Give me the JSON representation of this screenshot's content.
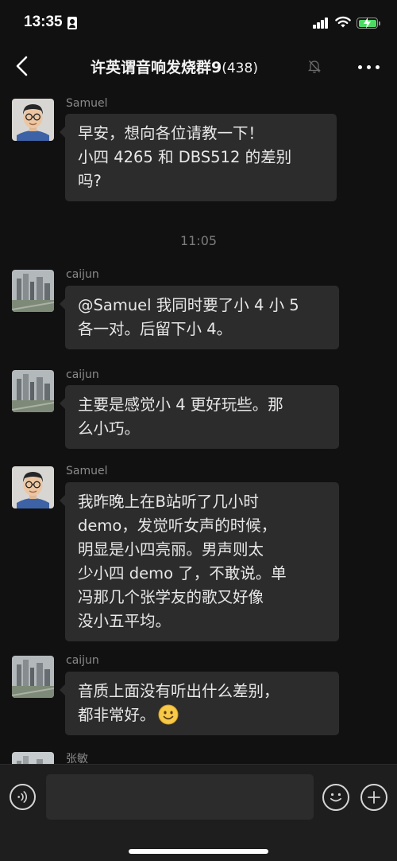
{
  "status_bar": {
    "time": "13:35",
    "icons": [
      "person-badge-icon",
      "signal-icon",
      "wifi-icon",
      "battery-charging-icon"
    ],
    "battery_color": "#4cd964"
  },
  "header": {
    "title": "许英谓音响发烧群9",
    "member_count": "(438)",
    "icons": [
      "back-icon",
      "mute-bell-icon",
      "more-icon"
    ]
  },
  "messages": [
    {
      "sender": "Samuel",
      "avatar": "samuel-avatar",
      "lines": [
        "早安，想向各位请教一下！",
        "小四 4265 和 DBS512 的差别",
        "吗?"
      ]
    },
    {
      "timestamp": "11:05"
    },
    {
      "sender": "caijun",
      "avatar": "city-avatar",
      "lines": [
        "@Samuel 我同时要了小 4 小 5",
        "各一对。后留下小 4。"
      ]
    },
    {
      "sender": "caijun",
      "avatar": "city-avatar",
      "lines": [
        "主要是感觉小 4 更好玩些。那",
        "么小巧。"
      ]
    },
    {
      "sender": "Samuel",
      "avatar": "samuel-avatar",
      "lines": [
        "我昨晚上在B站听了几小时",
        "demo，发觉听女声的时候，",
        "明显是小四亮丽。男声则太",
        "少小四 demo 了，不敢说。单",
        "冯那几个张学友的歌又好像",
        "没小五平均。"
      ]
    },
    {
      "sender": "caijun",
      "avatar": "city-avatar",
      "lines": [
        "音质上面没有听出什么差别，",
        "都非常好。"
      ],
      "emoji": "smile-emoji"
    },
    {
      "sender": "张敏",
      "avatar": "city-avatar"
    }
  ],
  "input_bar": {
    "message_value": "",
    "icons": [
      "voice-icon",
      "emoji-icon",
      "plus-icon"
    ]
  },
  "colors": {
    "background": "#111111",
    "bubble": "#2c2c2c",
    "input_bar": "#1e1e1e"
  }
}
